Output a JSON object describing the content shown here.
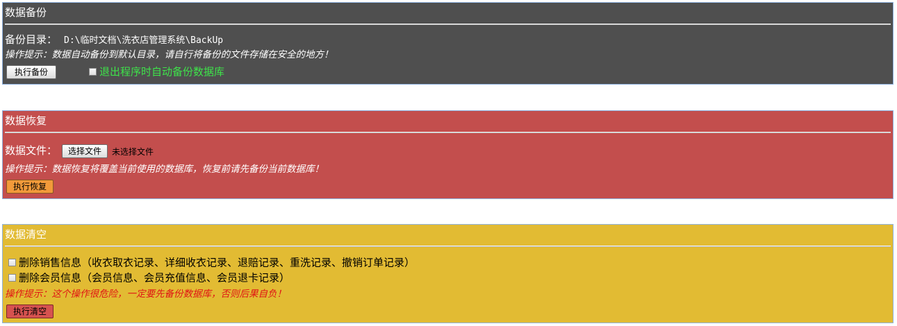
{
  "backup": {
    "title": "数据备份",
    "dir_label": "备份目录：",
    "dir_path": "D:\\临时文档\\洗衣店管理系统\\BackUp",
    "hint": "操作提示：数据自动备份到默认目录，请自行将备份的文件存储在安全的地方！",
    "button": "执行备份",
    "auto_backup_label": "退出程序时自动备份数据库",
    "auto_backup_checked": false
  },
  "restore": {
    "title": "数据恢复",
    "file_label": "数据文件：",
    "choose_button": "选择文件",
    "no_file_text": "未选择文件",
    "hint": "操作提示：数据恢复将覆盖当前使用的数据库，恢复前请先备份当前数据库！",
    "button": "执行恢复"
  },
  "clear": {
    "title": "数据清空",
    "options": [
      {
        "label": "删除销售信息（收衣取衣记录、详细收衣记录、退赔记录、重洗记录、撤销订单记录）",
        "checked": false
      },
      {
        "label": "删除会员信息（会员信息、会员充值信息、会员退卡记录）",
        "checked": false
      }
    ],
    "hint": "操作提示：这个操作很危险，一定要先备份数据库，否则后果自负！",
    "button": "执行清空"
  },
  "colors": {
    "backup_bg": "#4f4f4f",
    "restore_bg": "#c34e4d",
    "clear_bg": "#e2bb33",
    "auto_backup_text": "#3ee34a",
    "danger_hint": "#e01515"
  }
}
